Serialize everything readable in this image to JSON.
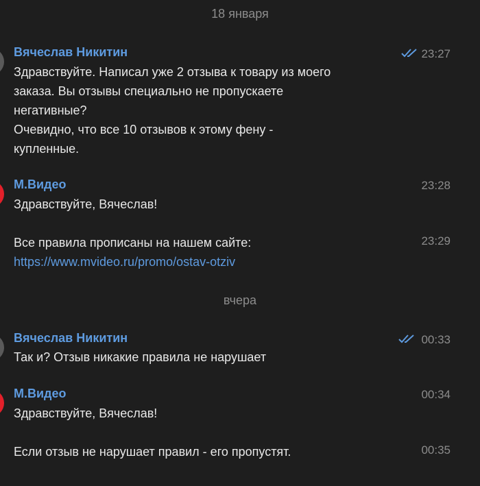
{
  "date_separators": [
    "18 января",
    "вчера"
  ],
  "messages": [
    {
      "sender": "Вячеслав Никитин",
      "time": "23:27",
      "read": true,
      "lines": [
        "Здравствуйте. Написал уже 2 отзыва к товару из моего",
        "заказа. Вы отзывы специально не пропускаете",
        "негативные?",
        "Очевидно, что все 10 отзывов к этому фену -",
        "купленные."
      ]
    },
    {
      "sender": "М.Видео",
      "time": "23:28",
      "lines": [
        "Здравствуйте, Вячеслав!"
      ]
    },
    {
      "time": "23:29",
      "lines": [
        "Все правила прописаны на нашем сайте:"
      ],
      "link": "https://www.mvideo.ru/promo/ostav-otziv"
    },
    {
      "sender": "Вячеслав Никитин",
      "time": "00:33",
      "read": true,
      "lines": [
        "Так и? Отзыв никакие правила не нарушает"
      ]
    },
    {
      "sender": "М.Видео",
      "time": "00:34",
      "lines": [
        "Здравствуйте, Вячеслав!"
      ]
    },
    {
      "time": "00:35",
      "lines": [
        "Если отзыв не нарушает правил - его пропустят."
      ]
    }
  ],
  "colors": {
    "background": "#1e1e1e",
    "sender_name": "#5e9be0",
    "link": "#5e9be0",
    "meta_text": "#8c8c8c",
    "mvideo_avatar": "#e3202a"
  },
  "icons": {
    "read_receipt": "double-check-icon"
  }
}
